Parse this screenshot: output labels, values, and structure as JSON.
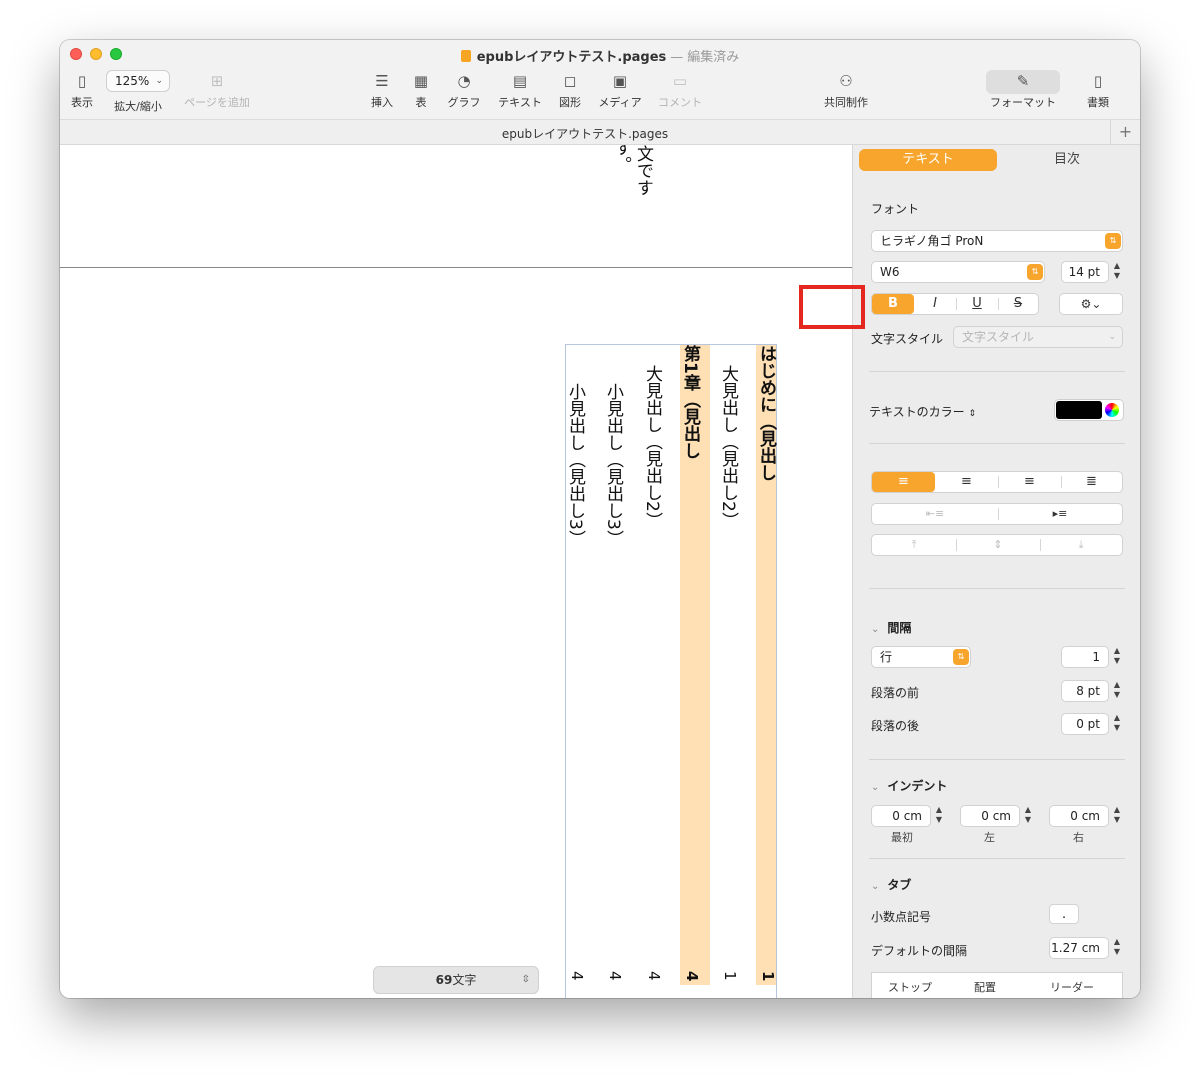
{
  "window": {
    "title": "epubレイアウトテスト.pages",
    "separator": "—",
    "status": "編集済み"
  },
  "toolbar": {
    "view_label": "表示",
    "zoom_value": "125%",
    "zoom_label": "拡大/縮小",
    "add_page_label": "ページを追加",
    "insert_label": "挿入",
    "table_label": "表",
    "chart_label": "グラフ",
    "text_label": "テキスト",
    "shape_label": "図形",
    "media_label": "メディア",
    "comment_label": "コメント",
    "collab_label": "共同制作",
    "format_label": "フォーマット",
    "document_label": "書類"
  },
  "tabbar": {
    "tab_title": "epubレイアウトテスト.pages",
    "plus": "+"
  },
  "canvas": {
    "prev_page_col1": "文です",
    "prev_page_col2": "す。",
    "toc": [
      {
        "text": "はじめに（見出し",
        "num": "1",
        "bold": true,
        "highlight": true
      },
      {
        "text": "大見出し（見出し2）",
        "num": "1",
        "bold": false,
        "highlight": false
      },
      {
        "text": "第1章（見出し",
        "num": "4",
        "bold": true,
        "highlight": true
      },
      {
        "text": "大見出し（見出し2）",
        "num": "4",
        "bold": false,
        "highlight": false
      },
      {
        "text": "小見出し（見出し3）",
        "num": "4",
        "bold": false,
        "highlight": false
      },
      {
        "text": "小見出し（見出し3）",
        "num": "4",
        "bold": false,
        "highlight": false
      }
    ],
    "word_count_num": "69",
    "word_count_unit": "文字"
  },
  "inspector": {
    "tab_text": "テキスト",
    "tab_toc": "目次",
    "font_section": "フォント",
    "font_family": "ヒラギノ角ゴ ProN",
    "font_weight": "W6",
    "font_size": "14 pt",
    "bold_label": "B",
    "italic_label": "I",
    "underline_label": "U",
    "strike_label": "S",
    "char_style_label": "文字スタイル",
    "char_style_value": "文字スタイル",
    "text_color_label": "テキストのカラー",
    "text_color_value": "#000000",
    "spacing_section": "間隔",
    "line_mode": "行",
    "line_value": "1",
    "before_para_label": "段落の前",
    "before_para_value": "8 pt",
    "after_para_label": "段落の後",
    "after_para_value": "0 pt",
    "indent_section": "インデント",
    "indent_first_value": "0 cm",
    "indent_first_label": "最初",
    "indent_left_value": "0 cm",
    "indent_left_label": "左",
    "indent_right_value": "0 cm",
    "indent_right_label": "右",
    "tabs_section": "タブ",
    "decimal_label": "小数点記号",
    "decimal_value": ".",
    "default_interval_label": "デフォルトの間隔",
    "default_interval_value": "1.27 cm",
    "tab_col_stop": "ストップ",
    "tab_col_align": "配置",
    "tab_col_leader": "リーダー"
  },
  "colors": {
    "accent": "#f7a52c",
    "highlight": "#ffe0b5",
    "annotation_red": "#e4281f"
  }
}
